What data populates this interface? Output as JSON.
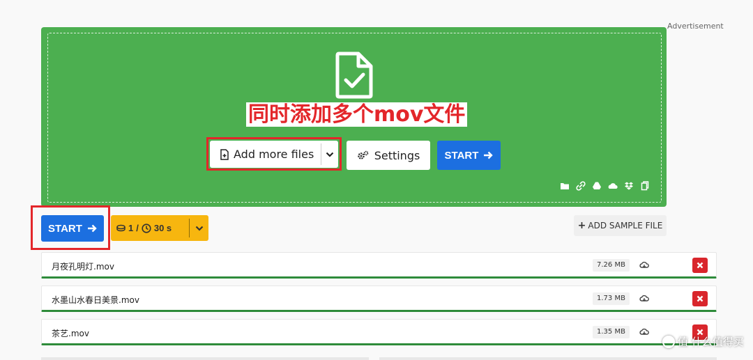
{
  "advertisement_label": "Advertisement",
  "annotation_text": "同时添加多个mov文件",
  "upload": {
    "add_more_files_label": "Add more files",
    "settings_label": "Settings",
    "start_label": "START"
  },
  "actions": {
    "start_label": "START",
    "quota_count": "1",
    "quota_separator": "/",
    "quota_time": "30 s",
    "add_sample_label": "ADD SAMPLE FILE"
  },
  "files": [
    {
      "name": "月夜孔明灯.mov",
      "size": "7.26 MB"
    },
    {
      "name": "水墨山水春日美景.mov",
      "size": "1.73 MB"
    },
    {
      "name": "茶艺.mov",
      "size": "1.35 MB"
    }
  ],
  "watermark": "值 什么值得买",
  "icons": [
    "file-check-icon",
    "file-add-icon",
    "chevron-down-icon",
    "gears-icon",
    "arrow-right-icon",
    "folder-icon",
    "link-icon",
    "google-drive-icon",
    "onedrive-icon",
    "dropbox-icon",
    "clipboard-icon",
    "coins-icon",
    "clock-icon",
    "plus-icon",
    "cloud-download-icon",
    "close-icon"
  ],
  "colors": {
    "dropzone": "#4caf50",
    "primary": "#1c6fe0",
    "quota": "#f7b60f",
    "delete": "#d9262c",
    "annotation": "#e3262a",
    "row_progress": "#2e8b3a"
  }
}
